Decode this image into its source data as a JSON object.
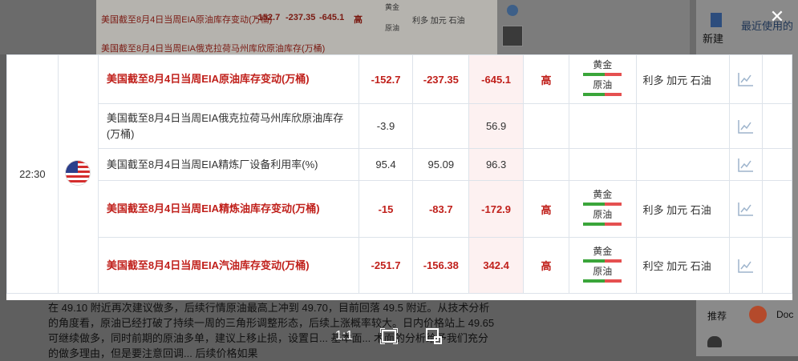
{
  "background": {
    "rows": [
      {
        "event": "美国截至8月4日当周EIA原油库存变动(万桶)",
        "previous": "-152.7",
        "forecast": "-237.35",
        "actual": "-645.1",
        "importance": "高",
        "votes": [
          "黄金",
          "原油"
        ],
        "effect": "利多 加元 石油"
      },
      {
        "event": "美国截至8月4日当周EIA俄克拉荷马州库欣原油库存(万桶)"
      }
    ],
    "right_panel": {
      "new_label": "新建",
      "recent_label": "最近使用的",
      "recommend_label": "推荐",
      "doc_label": "Doc"
    },
    "article_text": "在 49.10 附近再次建议做多，后续行情原油最高上冲到 49.70，目前回落 49.5 附近。从技术分析的角度看，原油已经打破了持续一周的三角形调整形态，后续上涨概率较大。日内价格站上 49.65 可继续做多，同时前期的原油多单，建议上移止损，设置日... 基本面... 术面的分析给予我们充分的做多理由，但是要注意回调... 后续价格如果"
  },
  "viewer": {
    "close_label": "✕",
    "toolbar": [
      "1:1",
      "fit-screen",
      "crop"
    ]
  },
  "table": {
    "time": "22:30",
    "country": "美国",
    "rows": [
      {
        "event": "美国截至8月4日当周EIA原油库存变动(万桶)",
        "highlight": true,
        "previous": "-152.7",
        "forecast": "-237.35",
        "actual": "-645.1",
        "importance": "高",
        "votes": [
          {
            "label": "黄金",
            "bull": 0.55
          },
          {
            "label": "原油",
            "bull": 0.55
          }
        ],
        "effect": "利多  加元 石油"
      },
      {
        "event": "美国截至8月4日当周EIA俄克拉荷马州库欣原油库存(万桶)",
        "highlight": false,
        "previous": "-3.9",
        "forecast": "",
        "actual": "56.9",
        "importance": "",
        "votes": [],
        "effect": ""
      },
      {
        "event": "美国截至8月4日当周EIA精炼厂设备利用率(%)",
        "highlight": false,
        "previous": "95.4",
        "forecast": "95.09",
        "actual": "96.3",
        "importance": "",
        "votes": [],
        "effect": ""
      },
      {
        "event": "美国截至8月4日当周EIA精炼油库存变动(万桶)",
        "highlight": true,
        "previous": "-15",
        "forecast": "-83.7",
        "actual": "-172.9",
        "importance": "高",
        "votes": [
          {
            "label": "黄金",
            "bull": 0.55
          },
          {
            "label": "原油",
            "bull": 0.55
          }
        ],
        "effect": "利多  加元 石油"
      },
      {
        "event": "美国截至8月4日当周EIA汽油库存变动(万桶)",
        "highlight": true,
        "previous": "-251.7",
        "forecast": "-156.38",
        "actual": "342.4",
        "importance": "高",
        "votes": [
          {
            "label": "黄金",
            "bull": 0.55
          },
          {
            "label": "原油",
            "bull": 0.55
          }
        ],
        "effect": "利空  加元 石油"
      }
    ]
  },
  "colors": {
    "accent_red": "#c0201b",
    "bull_green": "#3aa53a",
    "bear_red": "#e55050"
  }
}
